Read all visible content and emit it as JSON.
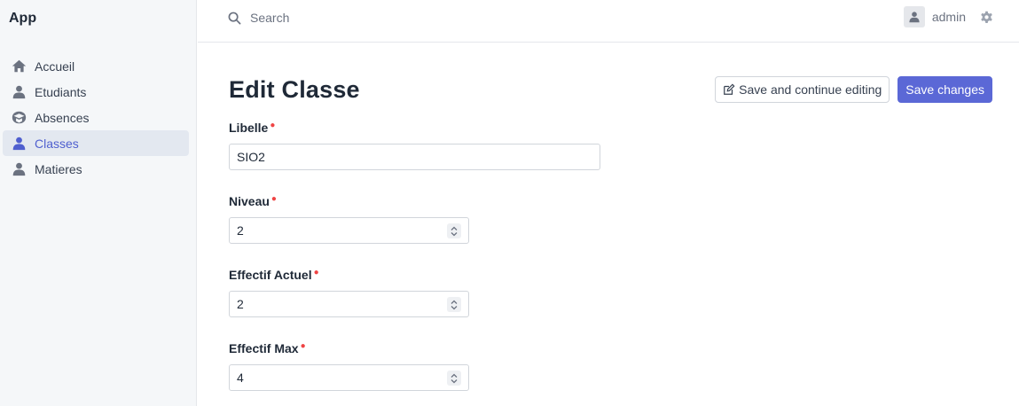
{
  "app": {
    "title": "App"
  },
  "sidebar": {
    "items": [
      {
        "label": "Accueil",
        "icon": "home-icon",
        "active": false
      },
      {
        "label": "Etudiants",
        "icon": "user-icon",
        "active": false
      },
      {
        "label": "Absences",
        "icon": "school-icon",
        "active": false
      },
      {
        "label": "Classes",
        "icon": "user-icon",
        "active": true
      },
      {
        "label": "Matieres",
        "icon": "user-icon",
        "active": false
      }
    ]
  },
  "topbar": {
    "search_placeholder": "Search",
    "username": "admin"
  },
  "page": {
    "title": "Edit Classe",
    "save_continue_label": "Save and continue editing",
    "save_label": "Save changes"
  },
  "form": {
    "fields": [
      {
        "label": "Libelle",
        "value": "SIO2",
        "type": "text",
        "required": true
      },
      {
        "label": "Niveau",
        "value": "2",
        "type": "number",
        "required": true
      },
      {
        "label": "Effectif Actuel",
        "value": "2",
        "type": "number",
        "required": true
      },
      {
        "label": "Effectif Max",
        "value": "4",
        "type": "number",
        "required": true
      }
    ]
  },
  "colors": {
    "accent": "#5b68d6",
    "active_bg": "#e3e8f0",
    "required": "#ef4444"
  }
}
